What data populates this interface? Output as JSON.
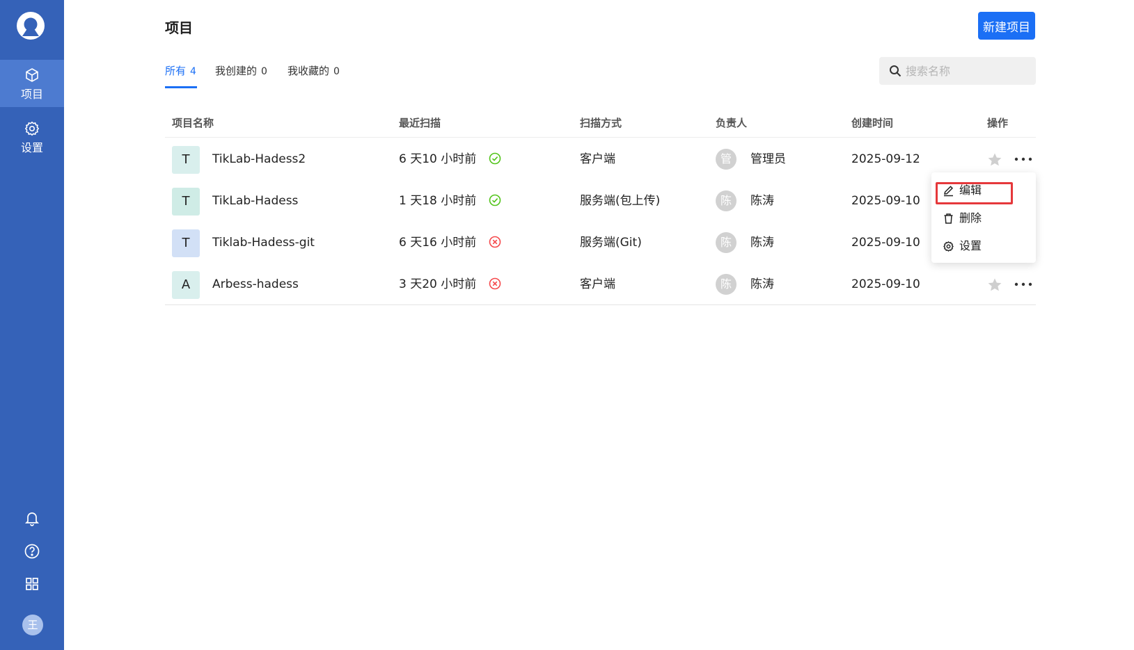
{
  "app": {
    "avatar_letter": "王"
  },
  "sidebar": {
    "items": [
      {
        "label": "项目",
        "icon": "cube-icon",
        "active": true
      },
      {
        "label": "设置",
        "icon": "gear-icon",
        "active": false
      }
    ],
    "bottom_icons": [
      "bell-icon",
      "help-icon",
      "apps-grid-icon"
    ]
  },
  "header": {
    "title": "项目",
    "new_button_label": "新建项目"
  },
  "tabs": [
    {
      "label": "所有",
      "count": "4",
      "active": true
    },
    {
      "label": "我创建的",
      "count": "0",
      "active": false
    },
    {
      "label": "我收藏的",
      "count": "0",
      "active": false
    }
  ],
  "search": {
    "placeholder": "搜索名称",
    "value": ""
  },
  "table": {
    "columns": [
      "项目名称",
      "最近扫描",
      "扫描方式",
      "负责人",
      "创建时间",
      "操作"
    ],
    "rows": [
      {
        "icon_letter": "T",
        "icon_color": "#d9efed",
        "name": "TikLab-Hadess2",
        "last_scan": "6 天10 小时前",
        "scan_status": "success",
        "scan_method": "客户端",
        "owner_initial": "管",
        "owner": "管理员",
        "created": "2025-09-12"
      },
      {
        "icon_letter": "T",
        "icon_color": "#cfece6",
        "name": "TikLab-Hadess",
        "last_scan": "1 天18 小时前",
        "scan_status": "success",
        "scan_method": "服务端(包上传)",
        "owner_initial": "陈",
        "owner": "陈涛",
        "created": "2025-09-10"
      },
      {
        "icon_letter": "T",
        "icon_color": "#d2e0f6",
        "name": "Tiklab-Hadess-git",
        "last_scan": "6 天16 小时前",
        "scan_status": "failed",
        "scan_method": "服务端(Git)",
        "owner_initial": "陈",
        "owner": "陈涛",
        "created": "2025-09-10"
      },
      {
        "icon_letter": "A",
        "icon_color": "#d9efed",
        "name": "Arbess-hadess",
        "last_scan": "3 天20 小时前",
        "scan_status": "failed",
        "scan_method": "客户端",
        "owner_initial": "陈",
        "owner": "陈涛",
        "created": "2025-09-10"
      }
    ]
  },
  "dropdown": {
    "items": [
      {
        "label": "编辑",
        "icon": "edit-icon"
      },
      {
        "label": "删除",
        "icon": "trash-icon"
      },
      {
        "label": "设置",
        "icon": "gear-icon"
      }
    ]
  },
  "colors": {
    "sidebar": "#3562b8",
    "accent": "#1b6ff5",
    "success": "#52c41a",
    "error": "#f5484b",
    "highlight": "#e5383b"
  }
}
